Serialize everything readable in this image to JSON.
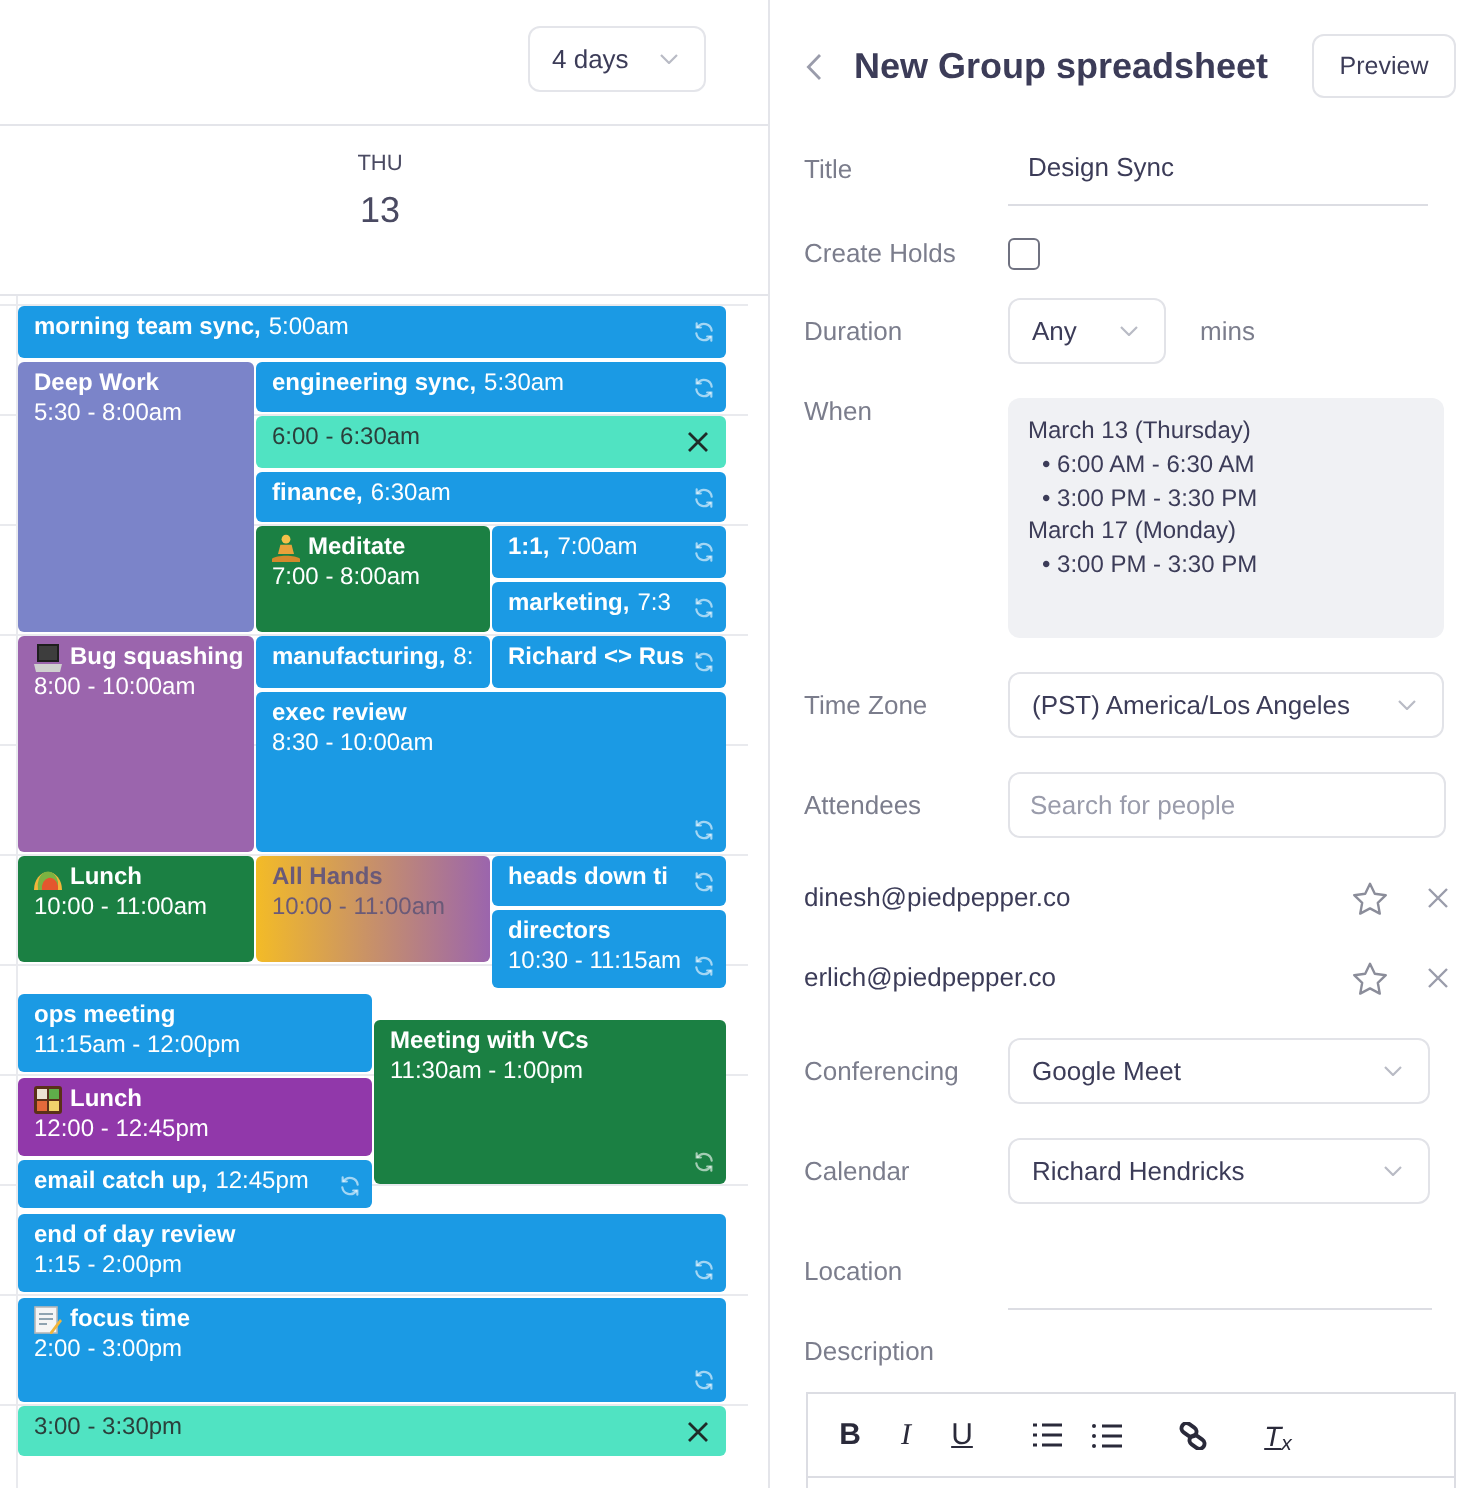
{
  "calendar": {
    "view_select": {
      "value": "4 days"
    },
    "day_header": {
      "weekday": "THU",
      "date": "13"
    }
  },
  "events": [
    {
      "kind": "event",
      "title": "morning team sync,",
      "time": "5:00am",
      "color": "#1b9ae4",
      "recurring": true
    },
    {
      "kind": "event",
      "title": "Deep Work",
      "time": "5:30 - 8:00am",
      "color": "#7b84c9",
      "recurring": false
    },
    {
      "kind": "event",
      "title": "engineering sync,",
      "time": "5:30am",
      "color": "#1b9ae4",
      "recurring": true
    },
    {
      "kind": "hold",
      "time": "6:00 - 6:30am",
      "color": "#50e3c2",
      "recurring": false
    },
    {
      "kind": "event",
      "title": "finance,",
      "time": "6:30am",
      "color": "#1b9ae4",
      "recurring": true
    },
    {
      "kind": "event",
      "title": "Meditate",
      "time": "7:00 - 8:00am",
      "color": "#1b8043",
      "recurring": false
    },
    {
      "kind": "event",
      "title": "1:1,",
      "time": "7:00am",
      "color": "#1b9ae4",
      "recurring": true
    },
    {
      "kind": "event",
      "title": "marketing,",
      "time": "7:3",
      "color": "#1b9ae4",
      "recurring": true
    },
    {
      "kind": "event",
      "title": "Bug squashing",
      "time": "8:00 - 10:00am",
      "color": "#9b65ad",
      "recurring": false
    },
    {
      "kind": "event",
      "title": "manufacturing,",
      "time": "8:",
      "color": "#1b9ae4",
      "recurring": false
    },
    {
      "kind": "event",
      "title": "Richard <> Rus",
      "color": "#1b9ae4",
      "recurring": true
    },
    {
      "kind": "event",
      "title": "exec review",
      "time": "8:30 - 10:00am",
      "color": "#1b9ae4",
      "recurring": true
    },
    {
      "kind": "event",
      "title": "Lunch",
      "time": "10:00 - 11:00am",
      "color": "#1b8043",
      "recurring": false
    },
    {
      "kind": "tentative",
      "title": "All Hands",
      "time": "10:00 - 11:00am",
      "color": "#f3bb27",
      "recurring": false
    },
    {
      "kind": "event",
      "title": "heads down ti",
      "color": "#1b9ae4",
      "recurring": true
    },
    {
      "kind": "event",
      "title": "directors",
      "time": "10:30 - 11:15am",
      "color": "#1b9ae4",
      "recurring": true
    },
    {
      "kind": "event",
      "title": "ops meeting",
      "time": "11:15am - 12:00pm",
      "color": "#1b9ae4",
      "recurring": false
    },
    {
      "kind": "event",
      "title": "Meeting with VCs",
      "time": "11:30am - 1:00pm",
      "color": "#1b8043",
      "recurring": true
    },
    {
      "kind": "event",
      "title": "Lunch",
      "time": "12:00 - 12:45pm",
      "color": "#9138aa",
      "recurring": false
    },
    {
      "kind": "event",
      "title": "email catch up,",
      "time": "12:45pm",
      "color": "#1b9ae4",
      "recurring": true
    },
    {
      "kind": "event",
      "title": "end of day review",
      "time": "1:15 - 2:00pm",
      "color": "#1b9ae4",
      "recurring": true
    },
    {
      "kind": "event",
      "title": "focus time",
      "time": "2:00 - 3:00pm",
      "color": "#1b9ae4",
      "recurring": true
    },
    {
      "kind": "hold",
      "time": "3:00 - 3:30pm",
      "color": "#50e3c2",
      "recurring": false
    }
  ],
  "panel": {
    "title": "New Group spreadsheet",
    "preview_button": "Preview",
    "form": {
      "title": {
        "label": "Title",
        "value": "Design Sync"
      },
      "create_holds": {
        "label": "Create Holds",
        "checked": false
      },
      "duration": {
        "label": "Duration",
        "value": "Any",
        "unit": "mins"
      },
      "when": {
        "label": "When",
        "dates": [
          {
            "date": "March 13 (Thursday)",
            "slots": [
              "• 6:00 AM - 6:30 AM",
              "• 3:00 PM - 3:30 PM"
            ]
          },
          {
            "date": "March 17 (Monday)",
            "slots": [
              "• 3:00 PM - 3:30 PM"
            ]
          }
        ]
      },
      "time_zone": {
        "label": "Time Zone",
        "value": "(PST) America/Los Angeles"
      },
      "attendees": {
        "label": "Attendees",
        "placeholder": "Search for people",
        "people": [
          {
            "email": "dinesh@piedpepper.co",
            "starred": false
          },
          {
            "email": "erlich@piedpepper.co",
            "starred": false
          }
        ]
      },
      "conferencing": {
        "label": "Conferencing",
        "value": "Google Meet"
      },
      "calendar": {
        "label": "Calendar",
        "value": "Richard Hendricks"
      },
      "location": {
        "label": "Location"
      },
      "description": {
        "label": "Description",
        "toolbar": [
          {
            "kind": "bold",
            "label": "B"
          },
          {
            "kind": "italic",
            "label": "I"
          },
          {
            "kind": "underline",
            "label": "U"
          },
          {
            "kind": "numbered"
          },
          {
            "kind": "bulleted"
          },
          {
            "kind": "link"
          },
          {
            "kind": "clear",
            "label": "T$_{x}$"
          }
        ]
      }
    }
  }
}
